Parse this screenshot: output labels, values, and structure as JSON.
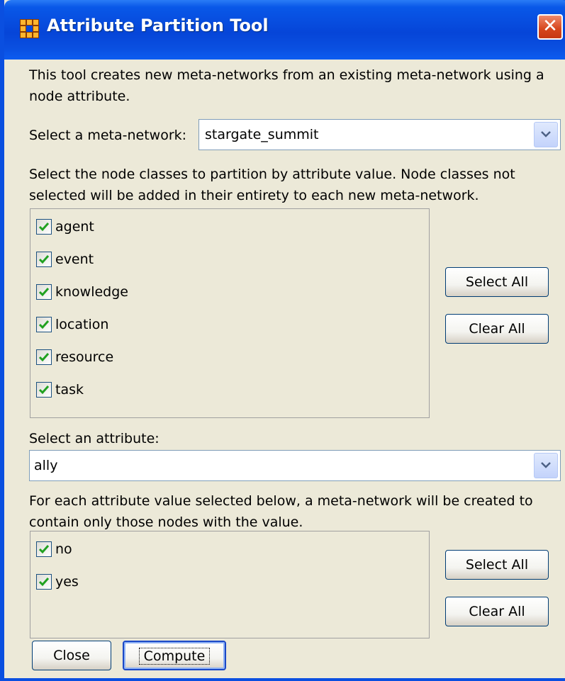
{
  "window": {
    "title": "Attribute Partition Tool",
    "close_glyph": "✕",
    "title_icon": "network-grid-icon"
  },
  "intro": {
    "line1": "This tool creates new meta-networks from an existing meta-network using a",
    "line2": "node attribute."
  },
  "meta_network": {
    "label": "Select a meta-network:",
    "selected": "stargate_summit"
  },
  "node_classes": {
    "instructions_line1": "Select the node classes to partition by attribute value. Node classes not",
    "instructions_line2": "selected will be added in their entirety to each new meta-network.",
    "items": [
      {
        "label": "agent",
        "checked": true
      },
      {
        "label": "event",
        "checked": true
      },
      {
        "label": "knowledge",
        "checked": true
      },
      {
        "label": "location",
        "checked": true
      },
      {
        "label": "resource",
        "checked": true
      },
      {
        "label": "task",
        "checked": true
      }
    ],
    "select_all_label": "Select All",
    "clear_all_label": "Clear All"
  },
  "attribute": {
    "label": "Select an attribute:",
    "selected": "ally"
  },
  "attribute_values": {
    "instructions_line1": "For each attribute value selected below, a meta-network will be created to",
    "instructions_line2": "contain only those nodes with the value.",
    "items": [
      {
        "label": "no",
        "checked": true
      },
      {
        "label": "yes",
        "checked": true
      }
    ],
    "select_all_label": "Select All",
    "clear_all_label": "Clear All"
  },
  "footer": {
    "close_label": "Close",
    "compute_label": "Compute"
  },
  "colors": {
    "title_bar": "#0a4fe0",
    "dialog_bg": "#ece9d8",
    "checkmark": "#21a121",
    "close_button": "#d6451c"
  }
}
